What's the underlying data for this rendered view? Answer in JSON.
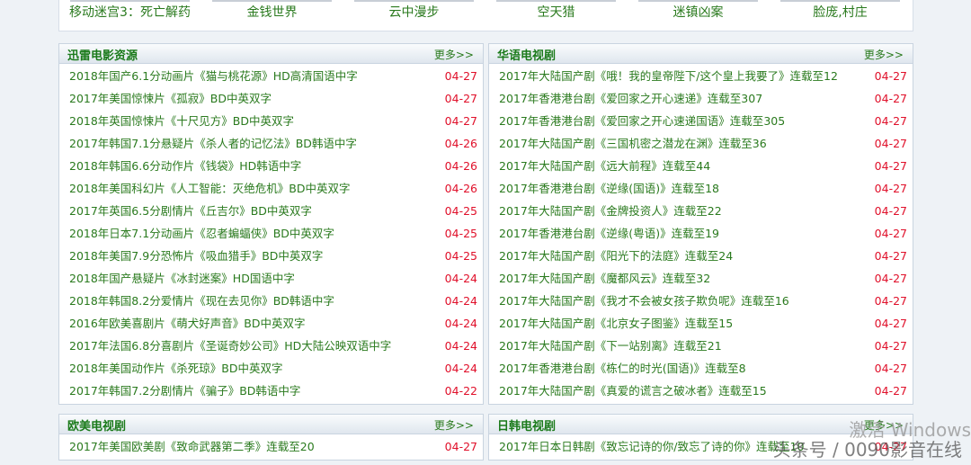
{
  "top_links": [
    "移动迷宫3：死亡解药",
    "金钱世界",
    "云中漫步",
    "空天猎",
    "迷镇凶案",
    "脸庞,村庄"
  ],
  "more_label": "更多>>",
  "panels": [
    {
      "title": "迅雷电影资源",
      "items": [
        [
          "2018年国产6.1分动画片《猫与桃花源》HD高清国语中字",
          "04-27"
        ],
        [
          "2017年美国惊悚片《孤寂》BD中英双字",
          "04-27"
        ],
        [
          "2018年英国惊悚片《十尺见方》BD中英双字",
          "04-27"
        ],
        [
          "2017年韩国7.1分悬疑片《杀人者的记忆法》BD韩语中字",
          "04-26"
        ],
        [
          "2018年韩国6.6分动作片《钱袋》HD韩语中字",
          "04-26"
        ],
        [
          "2018年美国科幻片《人工智能：灭绝危机》BD中英双字",
          "04-26"
        ],
        [
          "2017年英国6.5分剧情片《丘吉尔》BD中英双字",
          "04-25"
        ],
        [
          "2018年日本7.1分动画片《忍者蝙蝠侠》BD中英双字",
          "04-25"
        ],
        [
          "2018年美国7.9分恐怖片《吸血猎手》BD中英双字",
          "04-25"
        ],
        [
          "2018年国产悬疑片《冰封迷案》HD国语中字",
          "04-24"
        ],
        [
          "2018年韩国8.2分爱情片《现在去见你》BD韩语中字",
          "04-24"
        ],
        [
          "2016年欧美喜剧片《萌犬好声音》BD中英双字",
          "04-24"
        ],
        [
          "2017年法国6.8分喜剧片《圣诞奇妙公司》HD大陆公映双语中字",
          "04-24"
        ],
        [
          "2018年美国动作片《杀死琼》BD中英双字",
          "04-24"
        ],
        [
          "2017年韩国7.2分剧情片《骗子》BD韩语中字",
          "04-22"
        ]
      ]
    },
    {
      "title": "华语电视剧",
      "items": [
        [
          "2017年大陆国产剧《哦！我的皇帝陛下/这个皇上我要了》连载至12",
          "04-27"
        ],
        [
          "2017年香港港台剧《爱回家之开心速递》连载至307",
          "04-27"
        ],
        [
          "2017年香港港台剧《爱回家之开心速递国语》连载至305",
          "04-27"
        ],
        [
          "2017年大陆国产剧《三国机密之潜龙在渊》连载至36",
          "04-27"
        ],
        [
          "2017年大陆国产剧《远大前程》连载至44",
          "04-27"
        ],
        [
          "2017年香港港台剧《逆缘(国语)》连载至18",
          "04-27"
        ],
        [
          "2017年大陆国产剧《金牌投资人》连载至22",
          "04-27"
        ],
        [
          "2017年香港港台剧《逆缘(粤语)》连载至19",
          "04-27"
        ],
        [
          "2017年大陆国产剧《阳光下的法庭》连载至24",
          "04-27"
        ],
        [
          "2017年大陆国产剧《魔都风云》连载至32",
          "04-27"
        ],
        [
          "2017年大陆国产剧《我才不会被女孩子欺负呢》连载至16",
          "04-27"
        ],
        [
          "2017年大陆国产剧《北京女子图鉴》连载至15",
          "04-27"
        ],
        [
          "2017年大陆国产剧《下一站别离》连载至21",
          "04-27"
        ],
        [
          "2017年香港港台剧《栋仁的时光(国语)》连载至8",
          "04-27"
        ],
        [
          "2017年大陆国产剧《真爱的谎言之破冰者》连载至15",
          "04-27"
        ]
      ]
    },
    {
      "title": "欧美电视剧",
      "items": [
        [
          "2017年美国欧美剧《致命武器第二季》连载至20",
          "04-27"
        ]
      ]
    },
    {
      "title": "日韩电视剧",
      "items": [
        [
          "2017年日本日韩剧《致忘记诗的你/致忘了诗的你》连载至10",
          "04-27"
        ]
      ]
    }
  ],
  "watermark": "头条号 / 0090影音在线",
  "activation": "激活 Windows"
}
